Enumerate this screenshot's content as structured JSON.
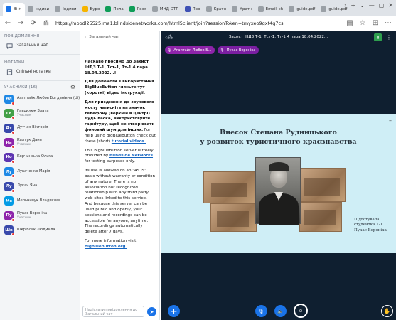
{
  "browser": {
    "tabs": [
      {
        "label": "Bi ×",
        "favicon_color": "#1a73e8",
        "active": true
      },
      {
        "label": "Індиви",
        "favicon_color": "#9aa0a6"
      },
      {
        "label": "Індиви",
        "favicon_color": "#9aa0a6"
      },
      {
        "label": "Буро",
        "favicon_color": "#f6b400"
      },
      {
        "label": "Пола",
        "favicon_color": "#0f9d58"
      },
      {
        "label": "Розк",
        "favicon_color": "#0f9d58"
      },
      {
        "label": "МНД ОТП",
        "favicon_color": "#9aa0a6"
      },
      {
        "label": "Про",
        "favicon_color": "#3f51b5"
      },
      {
        "label": "Кратн",
        "favicon_color": "#9aa0a6"
      },
      {
        "label": "Кратн",
        "favicon_color": "#9aa0a6"
      },
      {
        "label": "Email_ch",
        "favicon_color": "#9aa0a6"
      },
      {
        "label": "guide.pdf",
        "favicon_color": "#9aa0a6"
      },
      {
        "label": "guide.pdf",
        "favicon_color": "#9aa0a6"
      }
    ],
    "url": {
      "scheme": "https://",
      "host": "moodl25525.ma1.bbnextsitenetworks.com/html5client/join?sessionToken=tmyxeo9gxt4g7cs",
      "shown": "https://moodl25525.ma1.blindsidenetworks.com/html5client/join?sessionToken=tmyxeo9gxt4g7cs"
    }
  },
  "sidebar": {
    "messages_title": "ПОВІДОМЛЕННЯ",
    "public_chat": "Загальний чат",
    "notes_title": "НОТАТКИ",
    "shared_notes": "Спільні нотатки",
    "users_title": "УЧАСНИКИ (16)",
    "users": [
      {
        "initials": "Ал",
        "name": "Агаптайк Любов Богданівна (Ui)",
        "role": "",
        "color": "#1e88e5",
        "status": true
      },
      {
        "initials": "Гл",
        "name": "Гаврилюк Злата",
        "role": "Учасник",
        "color": "#43a047",
        "status": true
      },
      {
        "initials": "Ду",
        "name": "Дутчак Вікторія",
        "role": "",
        "color": "#3949ab",
        "status": true
      },
      {
        "initials": "Ка",
        "name": "Калтук Даня",
        "role": "Учасник",
        "color": "#8e24aa",
        "status": true
      },
      {
        "initials": "Ко",
        "name": "Корчинська Ольга",
        "role": "",
        "color": "#5e35b1",
        "status": true
      },
      {
        "initials": "Лу",
        "name": "Лукаченко Марія",
        "role": "",
        "color": "#1e88e5",
        "status": true
      },
      {
        "initials": "Лу",
        "name": "Лукач Яна",
        "role": "",
        "color": "#3949ab",
        "status": true
      },
      {
        "initials": "Ме",
        "name": "Мельничук Владислав",
        "role": "",
        "color": "#039be5",
        "status": false
      },
      {
        "initials": "Пу",
        "name": "Пукас Вероніка",
        "role": "Учасник",
        "color": "#8e24aa",
        "status": true
      },
      {
        "initials": "Шк",
        "name": "Шкрібляк Людмила",
        "role": "",
        "color": "#3949ab",
        "status": true
      }
    ]
  },
  "chat": {
    "header": "Загальний чат",
    "welcome_title": "Ласкаво просимо до Захист ІНДЗ Т-1, Тст-1, Тт-1 4 пара 18.04.2022...!",
    "help_text": "Для допомоги з використання BigBlueButton гляньте тут (короткі) відео інструкції.",
    "join_text": "Для приєднання до звукового мосту натисніть на значок телефону (верхній в центрі). Будь ласка, використовуйте гарнітуру, щоб не створювати фоновий шум для інших.",
    "help_en_prefix": "For help using BigBlueButton check out these (short)",
    "help_en_link": "tutorial videos.",
    "server_prefix": "This BigBlueButton server is freely provided by",
    "server_link": "Blindside Networks",
    "server_suffix": "for testing purposes only.",
    "terms": "Its use is allowed on an \"AS IS\" basis without warranty or condition of any nature. There is no association nor recognized relationship with any third party web sites linked to this service. And because this server can be used public and openly, your sessions and recordings can be accessible for anyone, anytime. The recordings automatically delete after 7 days.",
    "more_prefix": "For more information visit",
    "more_link": "bigbluebutton.org.",
    "input_placeholder": "Надіслати повідомлення до Загальний чат",
    "send_icon": "send-icon"
  },
  "presentation": {
    "title": "Захист ІНДЗ Т-1, Тст-1, Тт-1 4 пара 18.04.2022...",
    "talkers": [
      {
        "name": "Агаптайк Любов Б...",
        "color": "#8e24aa"
      },
      {
        "name": "Пукас Вероніка",
        "color": "#7b1fa2"
      }
    ],
    "slide_title_line1": "Внесок Степана Рудницького",
    "slide_title_line2": "у розвиток туристичного краєзнавства",
    "caption_line1": "Підготувала",
    "caption_line2": "студентка Т-1",
    "caption_line3": "Пукас Вероніка"
  },
  "colors": {
    "presentation_bg": "#0f1f30",
    "slide_bg": "#cfeef6",
    "accent": "#1a73e8"
  }
}
